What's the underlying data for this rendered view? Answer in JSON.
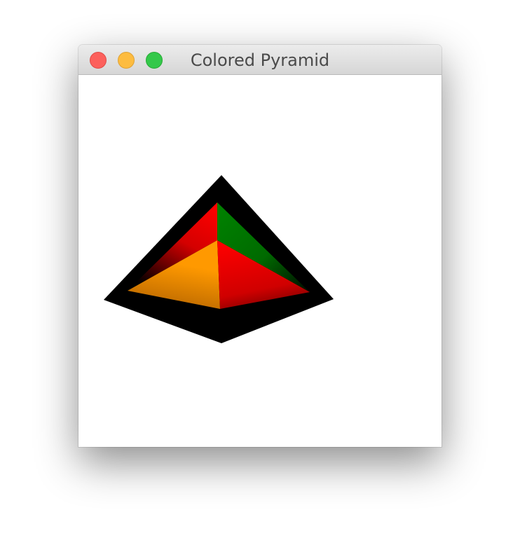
{
  "window": {
    "title": "Colored Pyramid"
  },
  "pyramid": {
    "colors": {
      "edge": "#000000",
      "left_face": "#ff9900",
      "front_face": "#ff0000",
      "back_left_face": "#ff0000",
      "back_right_face": "#008000"
    }
  }
}
